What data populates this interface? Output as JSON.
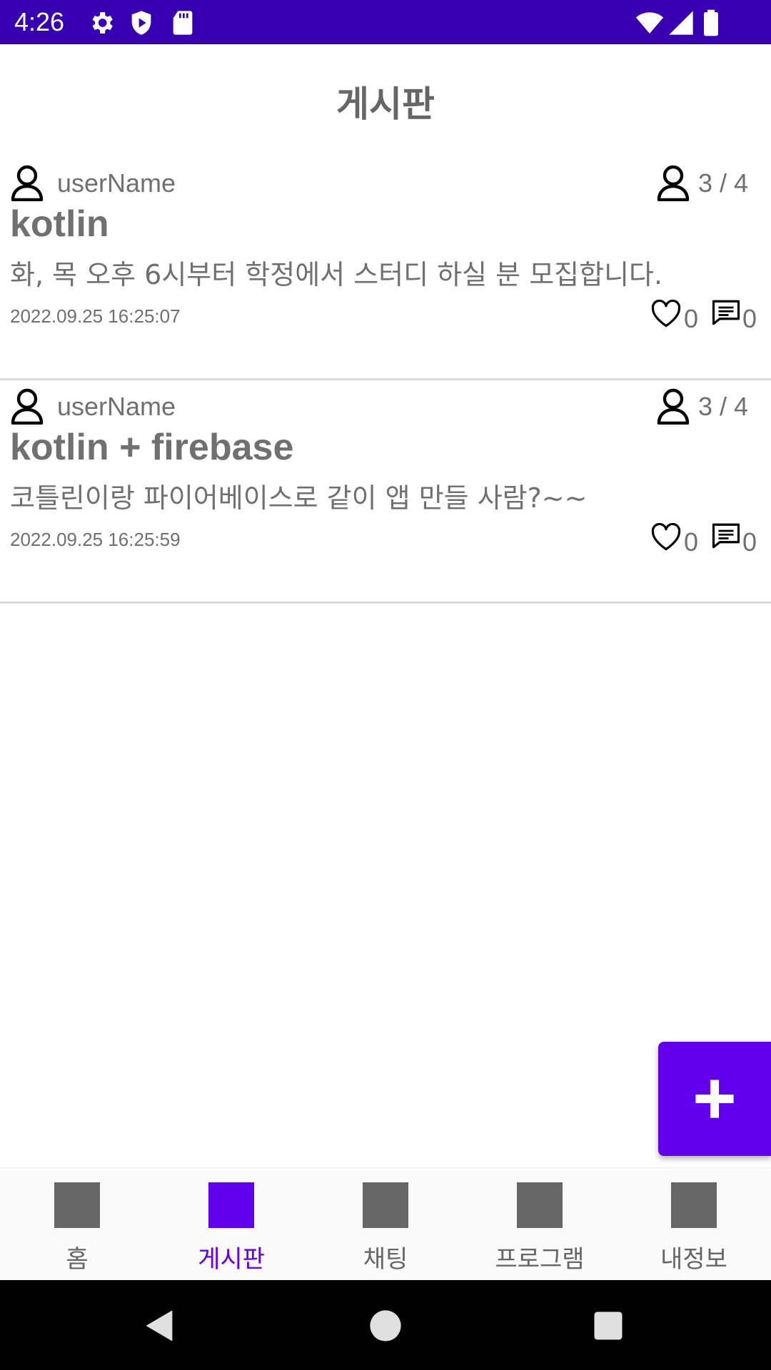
{
  "status_bar": {
    "time": "4:26",
    "icons": [
      "gear-icon",
      "shield-play-icon",
      "sd-card-icon",
      "wifi-icon",
      "signal-icon",
      "battery-icon"
    ]
  },
  "header": {
    "title": "게시판"
  },
  "posts": [
    {
      "user_name": "userName",
      "members": "3 / 4",
      "title": "kotlin",
      "body": "화, 목 오후 6시부터 학정에서 스터디 하실 분 모집합니다.",
      "date": "2022.09.25 16:25:07",
      "likes": "0",
      "comments": "0"
    },
    {
      "user_name": "userName",
      "members": "3 / 4",
      "title": "kotlin + firebase",
      "body": "코틀린이랑 파이어베이스로 같이 앱 만들 사람?~~",
      "date": "2022.09.25 16:25:59",
      "likes": "0",
      "comments": "0"
    }
  ],
  "fab": {
    "icon": "plus-icon"
  },
  "bottom_nav": {
    "items": [
      {
        "label": "홈",
        "active": false
      },
      {
        "label": "게시판",
        "active": true
      },
      {
        "label": "채팅",
        "active": false
      },
      {
        "label": "프로그램",
        "active": false
      },
      {
        "label": "내정보",
        "active": false
      }
    ]
  },
  "colors": {
    "status_bar": "#3700b3",
    "accent": "#6200ee",
    "text_gray": "#707070",
    "nav_icon_gray": "#666666"
  }
}
